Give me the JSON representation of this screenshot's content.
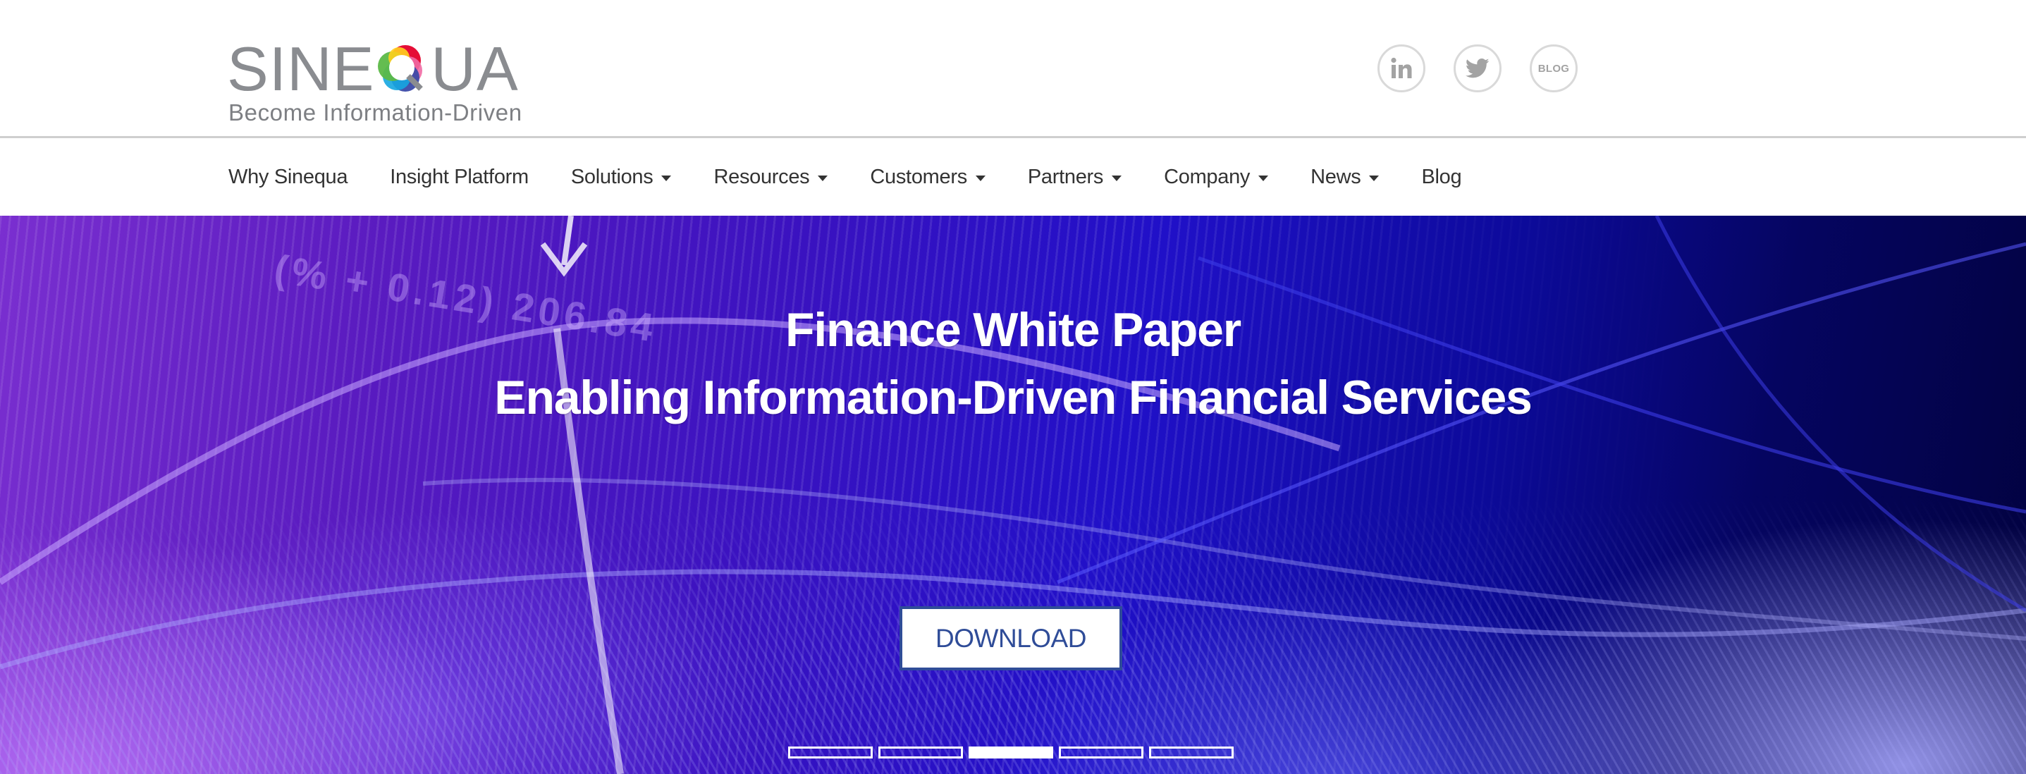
{
  "brand": {
    "name_left": "SINE",
    "name_right": "UA",
    "q_letter": "Q",
    "tagline": "Become Information-Driven",
    "logo_gray": "#8a8c90",
    "q_colors": [
      "#e4002b",
      "#f06aa4",
      "#3b4aa8",
      "#15a6e0",
      "#5cb947",
      "#ffd21f"
    ]
  },
  "social": [
    {
      "name": "linkedin",
      "icon": "linkedin-icon",
      "label": "in"
    },
    {
      "name": "twitter",
      "icon": "twitter-icon",
      "label": ""
    },
    {
      "name": "blog",
      "icon": "blog-icon",
      "label": "BLOG"
    }
  ],
  "nav": {
    "items": [
      {
        "label": "Why Sinequa",
        "dropdown": false
      },
      {
        "label": "Insight Platform",
        "dropdown": false
      },
      {
        "label": "Solutions",
        "dropdown": true
      },
      {
        "label": "Resources",
        "dropdown": true
      },
      {
        "label": "Customers",
        "dropdown": true
      },
      {
        "label": "Partners",
        "dropdown": true
      },
      {
        "label": "Company",
        "dropdown": true
      },
      {
        "label": "News",
        "dropdown": true
      },
      {
        "label": "Blog",
        "dropdown": false
      }
    ]
  },
  "hero": {
    "title_line1": "Finance White Paper",
    "title_line2": "Enabling Information-Driven Financial Services",
    "background_text": "(% + 0.12) 206.84",
    "cta_label": "DOWNLOAD",
    "cta_color": "#2f4c98",
    "slides_total": 5,
    "active_slide": 3
  }
}
